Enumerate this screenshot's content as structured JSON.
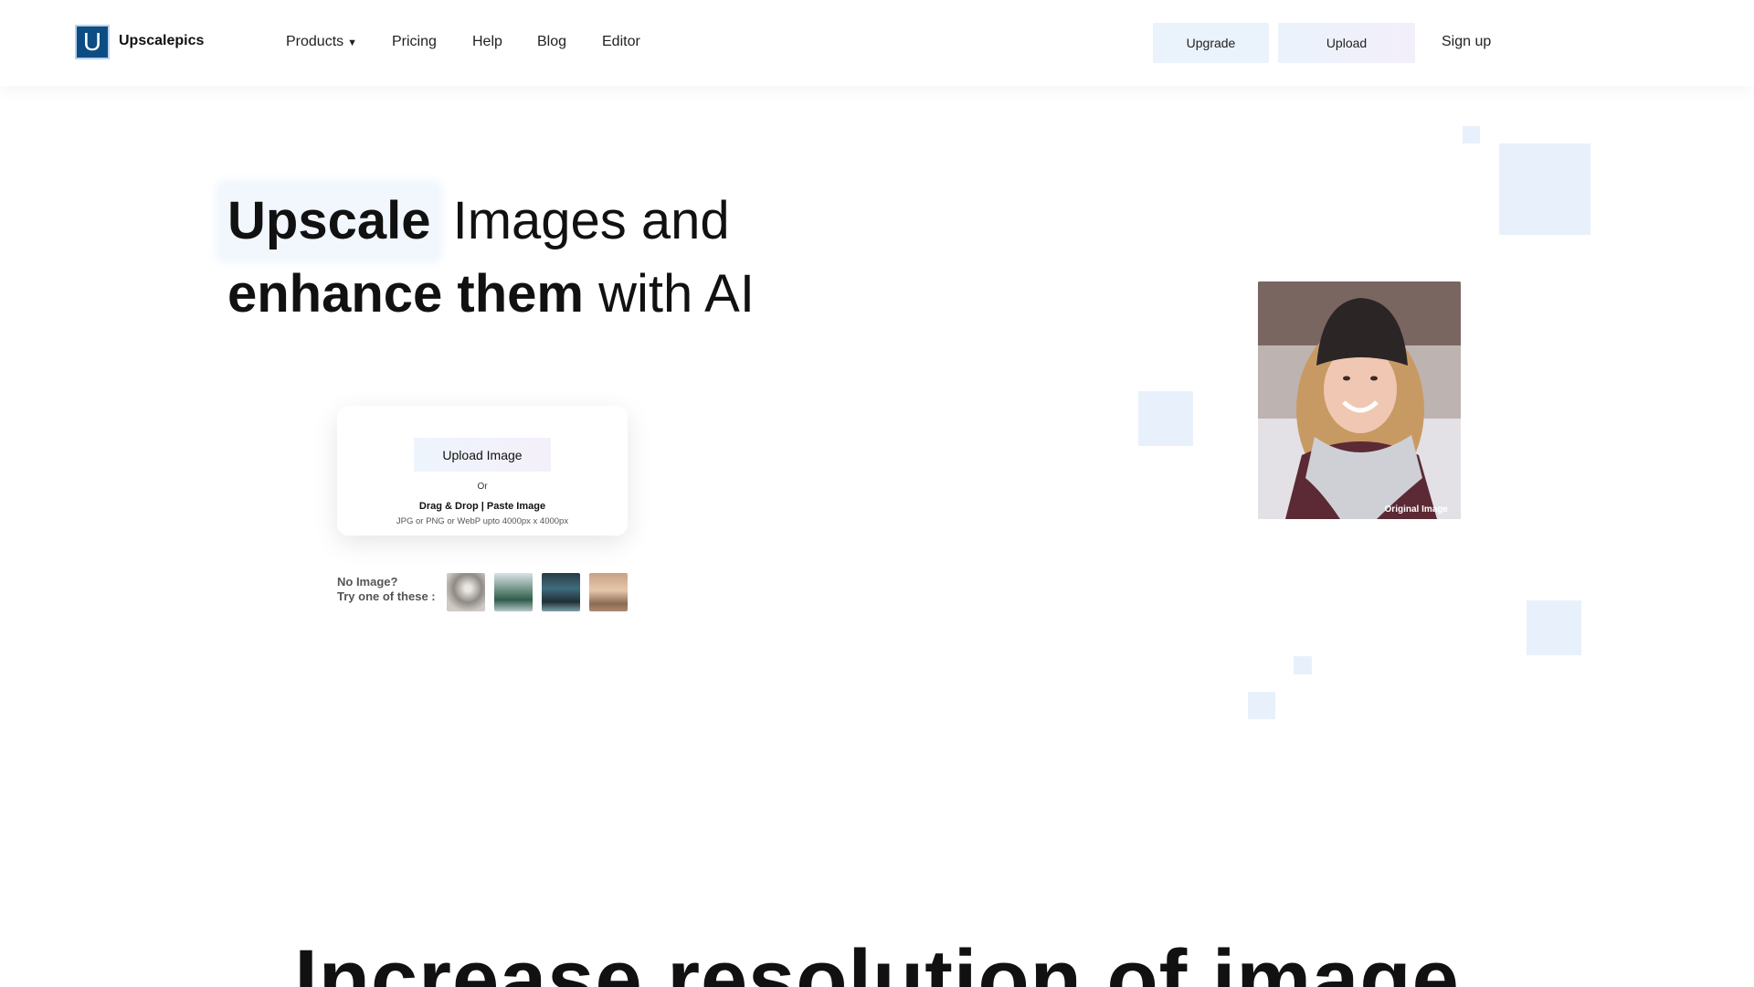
{
  "header": {
    "logo_letter": "U",
    "brand": "Upscalepics",
    "nav": [
      {
        "label": "Products",
        "has_dropdown": true
      },
      {
        "label": "Pricing"
      },
      {
        "label": "Help"
      },
      {
        "label": "Blog"
      },
      {
        "label": "Editor"
      }
    ],
    "upgrade_label": "Upgrade",
    "upload_label": "Upload",
    "signup_label": "Sign up"
  },
  "hero": {
    "title_highlight": "Upscale",
    "title_line1_rest": "Images and",
    "title_line2_bold": "enhance them",
    "title_line2_rest": "with AI",
    "upload_button": "Upload Image",
    "or_text": "Or",
    "drag_text": "Drag & Drop | Paste Image",
    "formats_text": "JPG or PNG or WebP upto 4000px x 4000px",
    "no_image_line1": "No Image?",
    "no_image_line2": "Try one of these :",
    "samples": [
      "sample-tree",
      "sample-lake",
      "sample-canal",
      "sample-laptop"
    ]
  },
  "preview": {
    "caption": "Original Image"
  },
  "section": {
    "title": "Increase resolution of image"
  },
  "colors": {
    "brand": "#0e4d83",
    "accent_bg": "#eaf2fb"
  }
}
